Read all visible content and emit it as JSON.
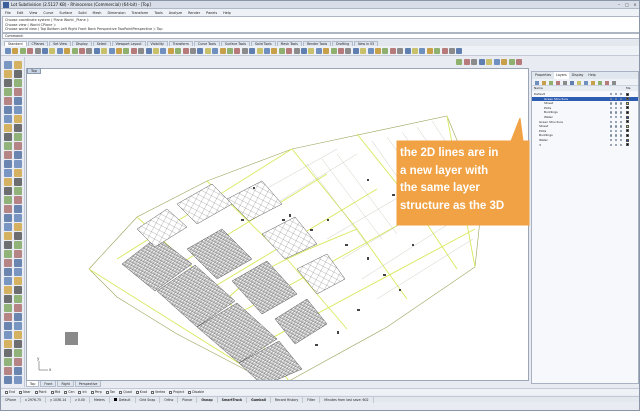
{
  "window": {
    "title": "Lot Subdivision (2.5127 KB) - Rhinoceros (Commercial) (64-bit) - [Top]",
    "controls": [
      "–",
      "□",
      "×"
    ]
  },
  "menu": [
    "File",
    "Edit",
    "View",
    "Curve",
    "Surface",
    "Solid",
    "Mesh",
    "Dimension",
    "Transform",
    "Tools",
    "Analyze",
    "Render",
    "Panels",
    "Help"
  ],
  "command_history": [
    "Choose coordinate system ( Plane  World  _Plane ):",
    "Choose view ( World  CPlane ):",
    "Choose world view ( Top  Bottom  Left  Right  Front  Back  Perspective  TwoPointPerspective ): Top"
  ],
  "command_prompt": "Command:",
  "toolbar_tabs": [
    "Standard",
    "CPlanes",
    "Set View",
    "Display",
    "Select",
    "Viewport Layout",
    "Visibility",
    "Transform",
    "Curve Tools",
    "Surface Tools",
    "Solid Tools",
    "Mesh Tools",
    "Render Tools",
    "Drafting",
    "New in V5"
  ],
  "active_toolbar_tab": "Standard",
  "viewport": {
    "title": "Top",
    "axis_labels": {
      "x": "x",
      "y": "y"
    }
  },
  "viewport_tabs": [
    "Top",
    "Front",
    "Right",
    "Perspective"
  ],
  "active_viewport_tab": "Top",
  "panel": {
    "tabs": [
      "Properties",
      "Layers",
      "Display",
      "Help"
    ],
    "active_tab": "Layers",
    "header": {
      "name": "Name",
      "material": "Ma"
    },
    "layers": [
      {
        "name": "Default",
        "indent": 0,
        "selected": false,
        "color": "#000000",
        "checked": true
      },
      {
        "name": "Green Structure",
        "indent": 2,
        "selected": true,
        "color": "#2b2b2b",
        "checked": false
      },
      {
        "name": "Street",
        "indent": 2,
        "selected": false,
        "color": "#d9e85c",
        "checked": false
      },
      {
        "name": "Plots",
        "indent": 2,
        "selected": false,
        "color": "#000000",
        "checked": false
      },
      {
        "name": "Buildings",
        "indent": 2,
        "selected": false,
        "color": "#000000",
        "checked": false
      },
      {
        "name": "Water",
        "indent": 2,
        "selected": false,
        "color": "#1a3dd6",
        "checked": false
      },
      {
        "name": "Green Structure",
        "indent": 1,
        "selected": false,
        "color": "#000000",
        "checked": false
      },
      {
        "name": "Street",
        "indent": 1,
        "selected": false,
        "color": "#d9e85c",
        "checked": false
      },
      {
        "name": "Plots",
        "indent": 1,
        "selected": false,
        "color": "#000000",
        "checked": false
      },
      {
        "name": "Buildings",
        "indent": 1,
        "selected": false,
        "color": "#000000",
        "checked": false
      },
      {
        "name": "Water",
        "indent": 1,
        "selected": false,
        "color": "#1a3dd6",
        "checked": false
      },
      {
        "name": "3",
        "indent": 1,
        "selected": false,
        "color": "#000000",
        "checked": false
      }
    ]
  },
  "callout": {
    "lines": [
      "the 2D lines are in",
      "a new layer with",
      "the same layer",
      "structure as the 3D"
    ],
    "fill": "#f0a244",
    "stroke": "#f0a244"
  },
  "osnaps": [
    "End",
    "Near",
    "Point",
    "Mid",
    "Cen",
    "Int",
    "Perp",
    "Tan",
    "Quad",
    "Knot",
    "Vertex",
    "Project",
    "Disable"
  ],
  "status": {
    "cplane": "CPlane",
    "x": "x 2976.75",
    "y": "y 1036.14",
    "z": "z 0.00",
    "units": "Meters",
    "layer": "Default",
    "toggles": [
      "Grid Snap",
      "Ortho",
      "Planar",
      "Osnap",
      "SmartTrack",
      "Gumball",
      "Record History",
      "Filter"
    ],
    "message": "Minutes from last save: 602"
  },
  "colors": {
    "title_bg": "#d8dee8",
    "selection": "#2d5db3",
    "street_lines": "#d9e85c"
  }
}
